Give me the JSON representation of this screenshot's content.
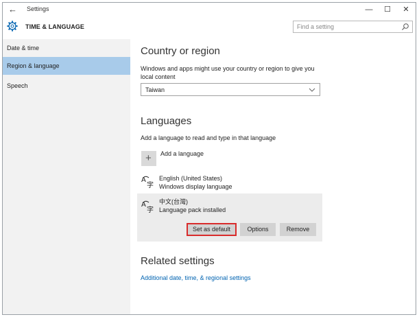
{
  "window": {
    "title": "Settings",
    "back_glyph": "←",
    "minimize": "—",
    "maximize": "☐",
    "close": "✕"
  },
  "header": {
    "section_title": "TIME & LANGUAGE",
    "section_icon": "gear-icon",
    "search_placeholder": "Find a setting"
  },
  "sidebar": {
    "items": [
      {
        "label": "Date & time",
        "active": false
      },
      {
        "label": "Region & language",
        "active": true
      },
      {
        "label": "Speech",
        "active": false
      }
    ]
  },
  "country": {
    "heading": "Country or region",
    "description_line1": "Windows and apps might use your country or region to give you",
    "description_line2": "local content",
    "selected": "Taiwan"
  },
  "languages": {
    "heading": "Languages",
    "description": "Add a language to read and type in that language",
    "add_label": "Add a language",
    "add_glyph": "+",
    "items": [
      {
        "name": "English (United States)",
        "status": "Windows display language"
      },
      {
        "name": "中文(台灣)",
        "status": "Language pack installed"
      }
    ],
    "buttons": {
      "set_default": "Set as default",
      "options": "Options",
      "remove": "Remove"
    }
  },
  "related": {
    "heading": "Related settings",
    "link": "Additional date, time, & regional settings"
  },
  "colors": {
    "accent": "#0063b1",
    "sidebar_active": "#a8cbea",
    "highlight_border": "#d92b2b"
  }
}
